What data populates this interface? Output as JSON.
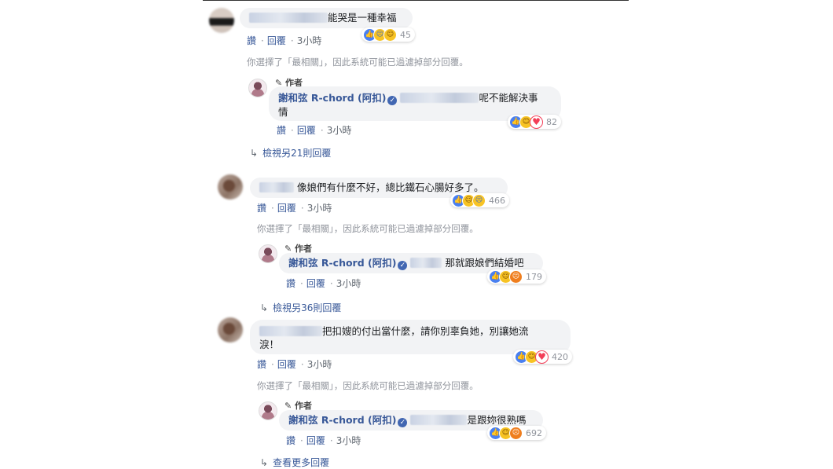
{
  "threads": [
    {
      "comment": {
        "text_after_name": "能哭是一種幸福",
        "reaction_count": "45",
        "reactions": [
          "like-icon",
          "sad-icon",
          "haha-icon"
        ]
      },
      "actions": {
        "like": "讚",
        "reply": "回覆",
        "time": "3小時"
      },
      "note": "你選擇了「最相關」，因此系統可能已過濾掉部分回覆。",
      "reply": {
        "author_tag": "作者",
        "author": "謝和弦 R-chord (阿扣)",
        "text": "呢不能解決事",
        "text_line2": "情",
        "reaction_count": "82",
        "reactions": [
          "like-icon",
          "haha-icon",
          "love-icon"
        ]
      },
      "reply_actions": {
        "like": "讚",
        "reply": "回覆",
        "time": "3小時"
      },
      "more": "檢視另21則回覆"
    },
    {
      "comment": {
        "text_after_name": "像娘們有什麼不好，總比鐵石心腸好多了。",
        "reaction_count": "466",
        "reactions": [
          "like-icon",
          "haha-icon",
          "sad-icon"
        ]
      },
      "actions": {
        "like": "讚",
        "reply": "回覆",
        "time": "3小時"
      },
      "note": "你選擇了「最相關」，因此系統可能已過濾掉部分回覆。",
      "reply": {
        "author_tag": "作者",
        "author": "謝和弦 R-chord (阿扣)",
        "text": "那就跟娘們結婚吧",
        "reaction_count": "179",
        "reactions": [
          "like-icon",
          "haha-icon",
          "angry-icon"
        ]
      },
      "reply_actions": {
        "like": "讚",
        "reply": "回覆",
        "time": "3小時"
      },
      "more": "檢視另36則回覆"
    },
    {
      "comment": {
        "text_after_name": "把扣嫂的付出當什麼，請你別辜負她，別讓她流",
        "text_line2": "淚！",
        "reaction_count": "420",
        "reactions": [
          "like-icon",
          "haha-icon",
          "love-icon"
        ]
      },
      "actions": {
        "like": "讚",
        "reply": "回覆",
        "time": "3小時"
      },
      "note": "你選擇了「最相關」，因此系統可能已過濾掉部分回覆。",
      "reply": {
        "author_tag": "作者",
        "author": "謝和弦 R-chord (阿扣)",
        "text": "是跟妳很熟嗎",
        "reaction_count": "692",
        "reactions": [
          "like-icon",
          "haha-icon",
          "angry-icon"
        ]
      },
      "reply_actions": {
        "like": "讚",
        "reply": "回覆",
        "time": "3小時"
      },
      "more": "查看更多回覆"
    }
  ],
  "colors": {
    "link": "#385898",
    "bubble": "#f2f3f5",
    "meta": "#90949c"
  }
}
